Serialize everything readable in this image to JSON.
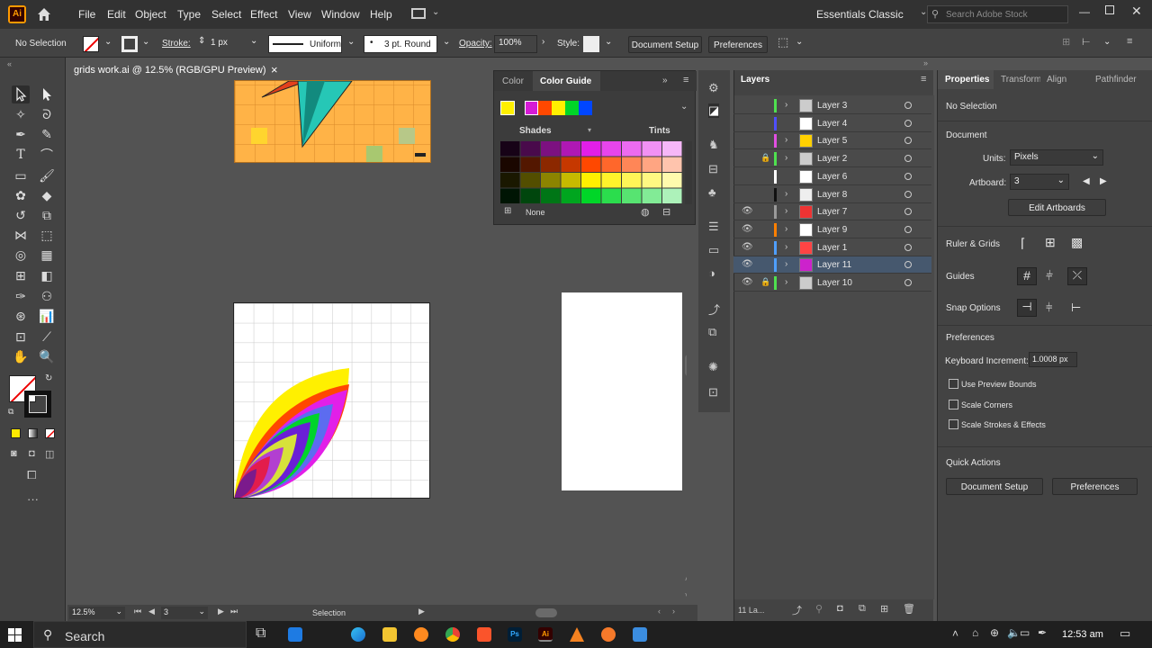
{
  "app": {
    "logo": "Ai",
    "home_icon": "home-icon"
  },
  "menu": [
    "File",
    "Edit",
    "Object",
    "Type",
    "Select",
    "Effect",
    "View",
    "Window",
    "Help"
  ],
  "workspace": "Essentials Classic",
  "search_placeholder": "Search Adobe Stock",
  "control": {
    "selection": "No Selection",
    "stroke_label": "Stroke:",
    "stroke_value": "1 px",
    "profile": "Uniform",
    "brush": "3 pt. Round",
    "opacity_label": "Opacity:",
    "opacity_value": "100%",
    "style_label": "Style:",
    "doc_setup": "Document Setup",
    "preferences": "Preferences"
  },
  "doc_tab": {
    "title": "grids work.ai @ 12.5% (RGB/GPU Preview)",
    "close": "×"
  },
  "status": {
    "zoom": "12.5%",
    "artboard": "3",
    "tool": "Selection"
  },
  "color_panel": {
    "tabs": [
      "Color",
      "Color Guide"
    ],
    "harmony": [
      "#d61bd6",
      "#ff4800",
      "#fff000",
      "#00d628",
      "#0046ff"
    ],
    "base": "#fff000",
    "shades": "Shades",
    "tints": "Tints",
    "none": "None"
  },
  "layers_panel": {
    "title": "Layers",
    "footer": "11 La...",
    "layers": [
      {
        "name": "Layer 3",
        "color": "#4fe14f",
        "eye": false,
        "lock": false,
        "sel": false,
        "thumb": "#ccc"
      },
      {
        "name": "Layer 4",
        "color": "#4f4fff",
        "eye": false,
        "lock": false,
        "sel": false,
        "thumb": "#fff"
      },
      {
        "name": "Layer 5",
        "color": "#e24fe2",
        "eye": false,
        "lock": false,
        "sel": false,
        "thumb": "#ffd000"
      },
      {
        "name": "Layer 2",
        "color": "#4fe14f",
        "eye": false,
        "lock": true,
        "sel": false,
        "thumb": "#ccc"
      },
      {
        "name": "Layer 6",
        "color": "#ffffff",
        "eye": false,
        "lock": false,
        "sel": false,
        "thumb": "#fff"
      },
      {
        "name": "Layer 8",
        "color": "#111111",
        "eye": false,
        "lock": false,
        "sel": false,
        "thumb": "#eee"
      },
      {
        "name": "Layer 7",
        "color": "#9a9a9a",
        "eye": true,
        "lock": false,
        "sel": false,
        "thumb": "#e33"
      },
      {
        "name": "Layer 9",
        "color": "#ff8000",
        "eye": true,
        "lock": false,
        "sel": false,
        "thumb": "#fff"
      },
      {
        "name": "Layer 1",
        "color": "#4f9fff",
        "eye": true,
        "lock": false,
        "sel": false,
        "thumb": "#f44"
      },
      {
        "name": "Layer 11",
        "color": "#4f9fff",
        "eye": true,
        "lock": false,
        "sel": true,
        "thumb": "#c2c"
      },
      {
        "name": "Layer 10",
        "color": "#4fe14f",
        "eye": true,
        "lock": true,
        "sel": false,
        "thumb": "#ccc"
      }
    ]
  },
  "properties": {
    "tabs": [
      "Properties",
      "Transform",
      "Align",
      "Pathfinder"
    ],
    "selection": "No Selection",
    "document": "Document",
    "units_label": "Units:",
    "units_value": "Pixels",
    "artboard_label": "Artboard:",
    "artboard_value": "3",
    "edit_artboards": "Edit Artboards",
    "rulers": "Ruler & Grids",
    "guides": "Guides",
    "snap": "Snap Options",
    "preferences": "Preferences",
    "kbd_label": "Keyboard Increment:",
    "kbd_value": "1.0008 px",
    "opt1": "Use Preview Bounds",
    "opt2": "Scale Corners",
    "opt3": "Scale Strokes & Effects",
    "quick": "Quick Actions",
    "doc_setup": "Document Setup",
    "prefs_btn": "Preferences"
  },
  "taskbar": {
    "search": "Search",
    "time": "12:53 am"
  }
}
